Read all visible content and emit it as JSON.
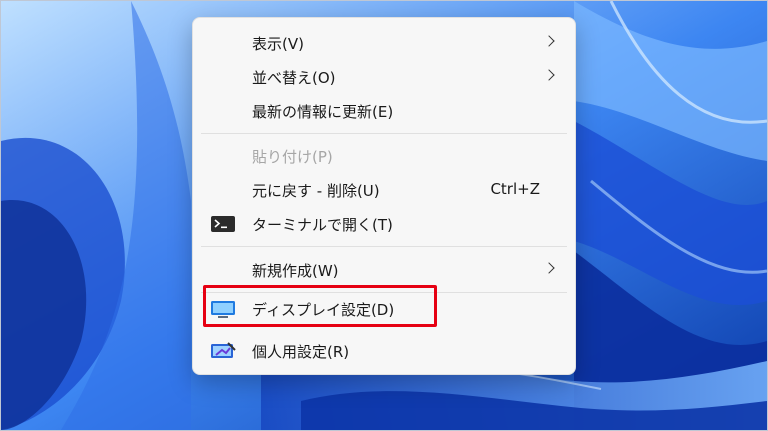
{
  "menu": {
    "items": [
      {
        "label": "表示(V)",
        "submenu": true
      },
      {
        "label": "並べ替え(O)",
        "submenu": true
      },
      {
        "label": "最新の情報に更新(E)"
      },
      {
        "label": "貼り付け(P)",
        "disabled": true
      },
      {
        "label": "元に戻す - 削除(U)",
        "shortcut": "Ctrl+Z"
      },
      {
        "label": "ターミナルで開く(T)",
        "icon": "terminal-icon"
      },
      {
        "label": "新規作成(W)",
        "submenu": true
      },
      {
        "label": "ディスプレイ設定(D)",
        "icon": "display-icon",
        "highlighted": true
      },
      {
        "label": "個人用設定(R)",
        "icon": "personalize-icon"
      }
    ]
  },
  "colors": {
    "highlight": "#e60012",
    "menu_bg": "#f7f7f7",
    "disabled_text": "#a6a6a6",
    "wallpaper_blue": "#1f5fe0"
  }
}
